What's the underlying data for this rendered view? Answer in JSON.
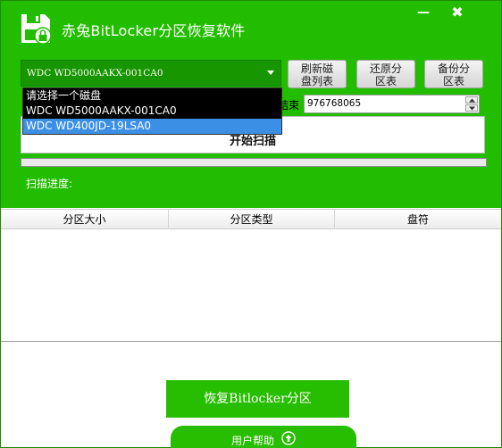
{
  "window": {
    "title": "赤兔BitLocker分区恢复软件",
    "minimize_glyph": "—",
    "close_glyph": "✖"
  },
  "disk_select": {
    "value": "WDC WD5000AAKX-001CA0",
    "options": [
      "请选择一个磁盘",
      "WDC WD5000AAKX-001CA0",
      "WDC WD400JD-19LSA0"
    ],
    "highlighted_index": 2
  },
  "buttons": {
    "refresh": [
      "刷新磁",
      "盘列表"
    ],
    "restore": [
      "还原分",
      "区表"
    ],
    "backup": [
      "备份分",
      "区表"
    ]
  },
  "range": {
    "end_label": "结束",
    "end_value": "976768065"
  },
  "scan": {
    "button_label": "开始扫描",
    "progress_label": "扫描进度:",
    "progress_fraction": 0
  },
  "table": {
    "columns": [
      "分区大小",
      "分区类型",
      "盘符"
    ],
    "rows": []
  },
  "footer": {
    "recover_button": "恢复Bitlocker分区",
    "help_label": "用户帮助"
  },
  "colors": {
    "brand_green": "#23bd00",
    "select_dark_green": "#189600",
    "dropdown_highlight": "#3b8fe4"
  }
}
